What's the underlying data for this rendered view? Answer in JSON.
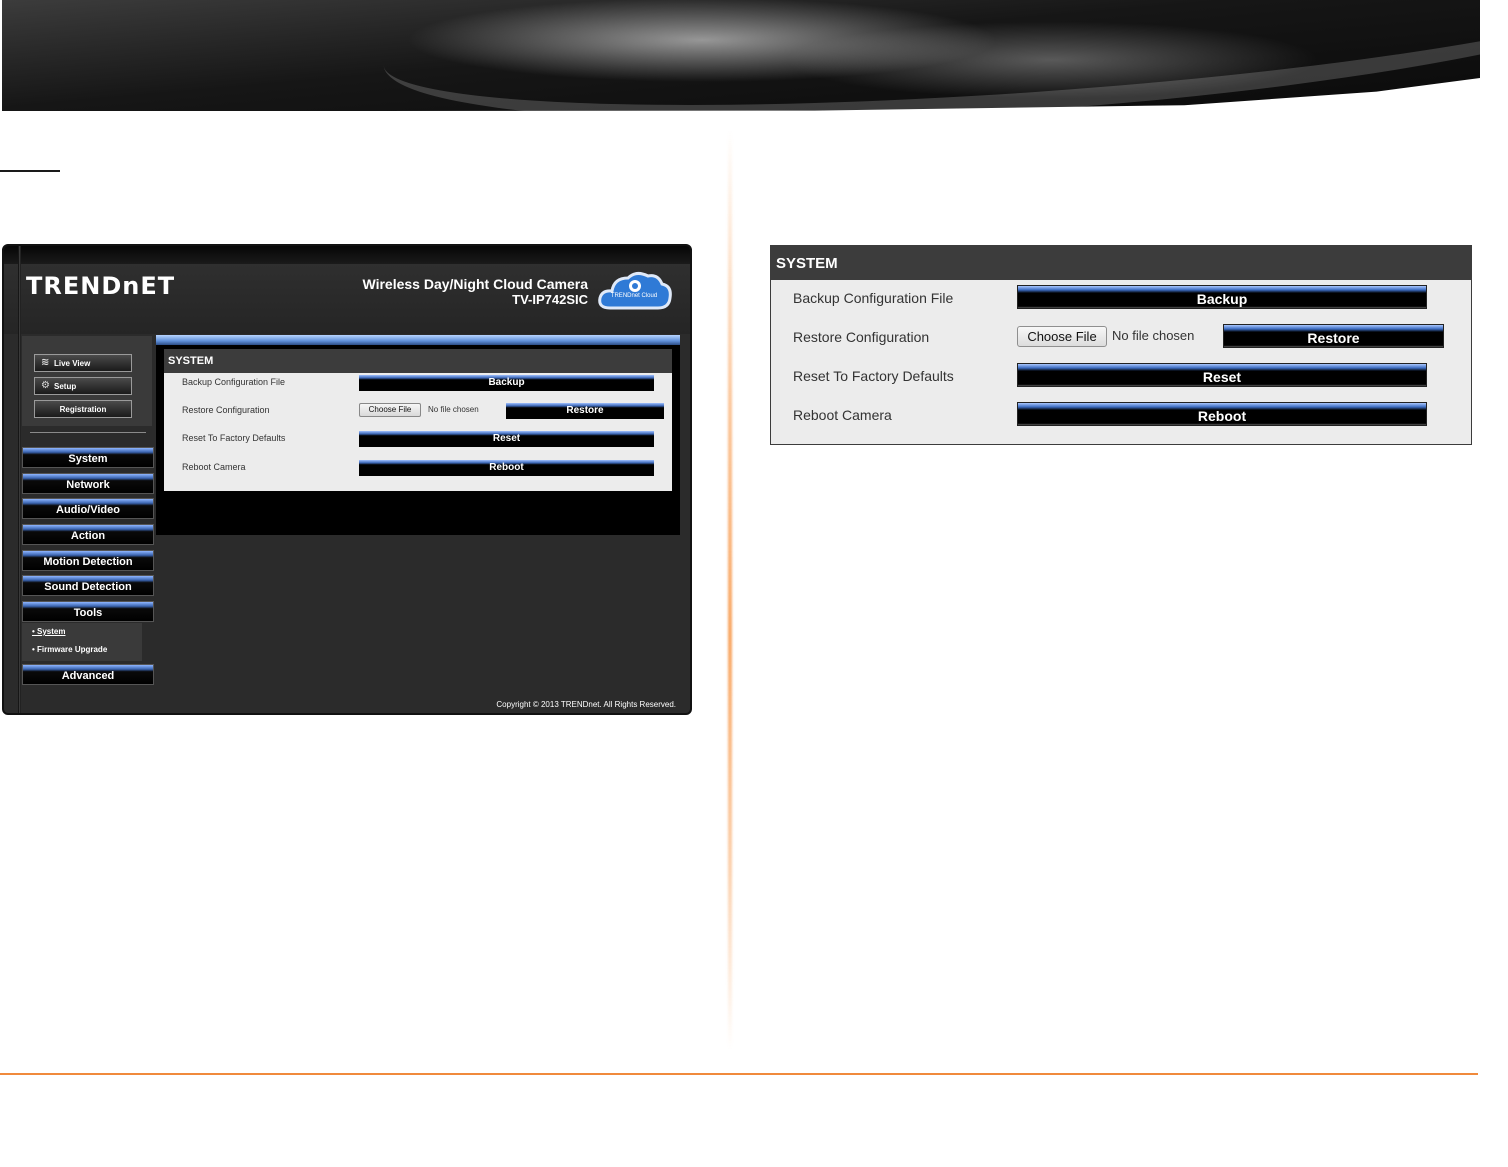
{
  "camera_ui": {
    "brand": "TRENDnET",
    "product_title": "Wireless Day/Night Cloud Camera",
    "product_model": "TV-IP742SIC",
    "cloud_label": "TRENDnet Cloud",
    "quick_buttons": [
      "Live View",
      "Setup",
      "Registration"
    ],
    "nav": [
      "System",
      "Network",
      "Audio/Video",
      "Action",
      "Motion Detection",
      "Sound Detection",
      "Tools",
      "Advanced"
    ],
    "tools_sub": [
      "• System",
      "• Firmware Upgrade"
    ],
    "panel": {
      "title": "SYSTEM",
      "rows": [
        {
          "label": "Backup Configuration File",
          "button": "Backup"
        },
        {
          "label": "Restore Configuration",
          "button": "Restore"
        },
        {
          "label": "Reset To Factory Defaults",
          "button": "Reset"
        },
        {
          "label": "Reboot Camera",
          "button": "Reboot"
        }
      ],
      "choose_file": "Choose File",
      "no_file": "No file chosen"
    },
    "copyright": "Copyright © 2013 TRENDnet. All Rights Reserved."
  },
  "zoom_panel": {
    "title": "SYSTEM",
    "rows": [
      {
        "label": "Backup Configuration File",
        "button": "Backup"
      },
      {
        "label": "Restore Configuration",
        "button": "Restore"
      },
      {
        "label": "Reset To Factory Defaults",
        "button": "Reset"
      },
      {
        "label": "Reboot Camera",
        "button": "Reboot"
      }
    ],
    "choose_file": "Choose File",
    "no_file": "No file chosen"
  },
  "colors": {
    "accent_orange": "#f08a3c",
    "panel_dark": "#3c3c3c",
    "button_blue": "#3b66b5"
  }
}
